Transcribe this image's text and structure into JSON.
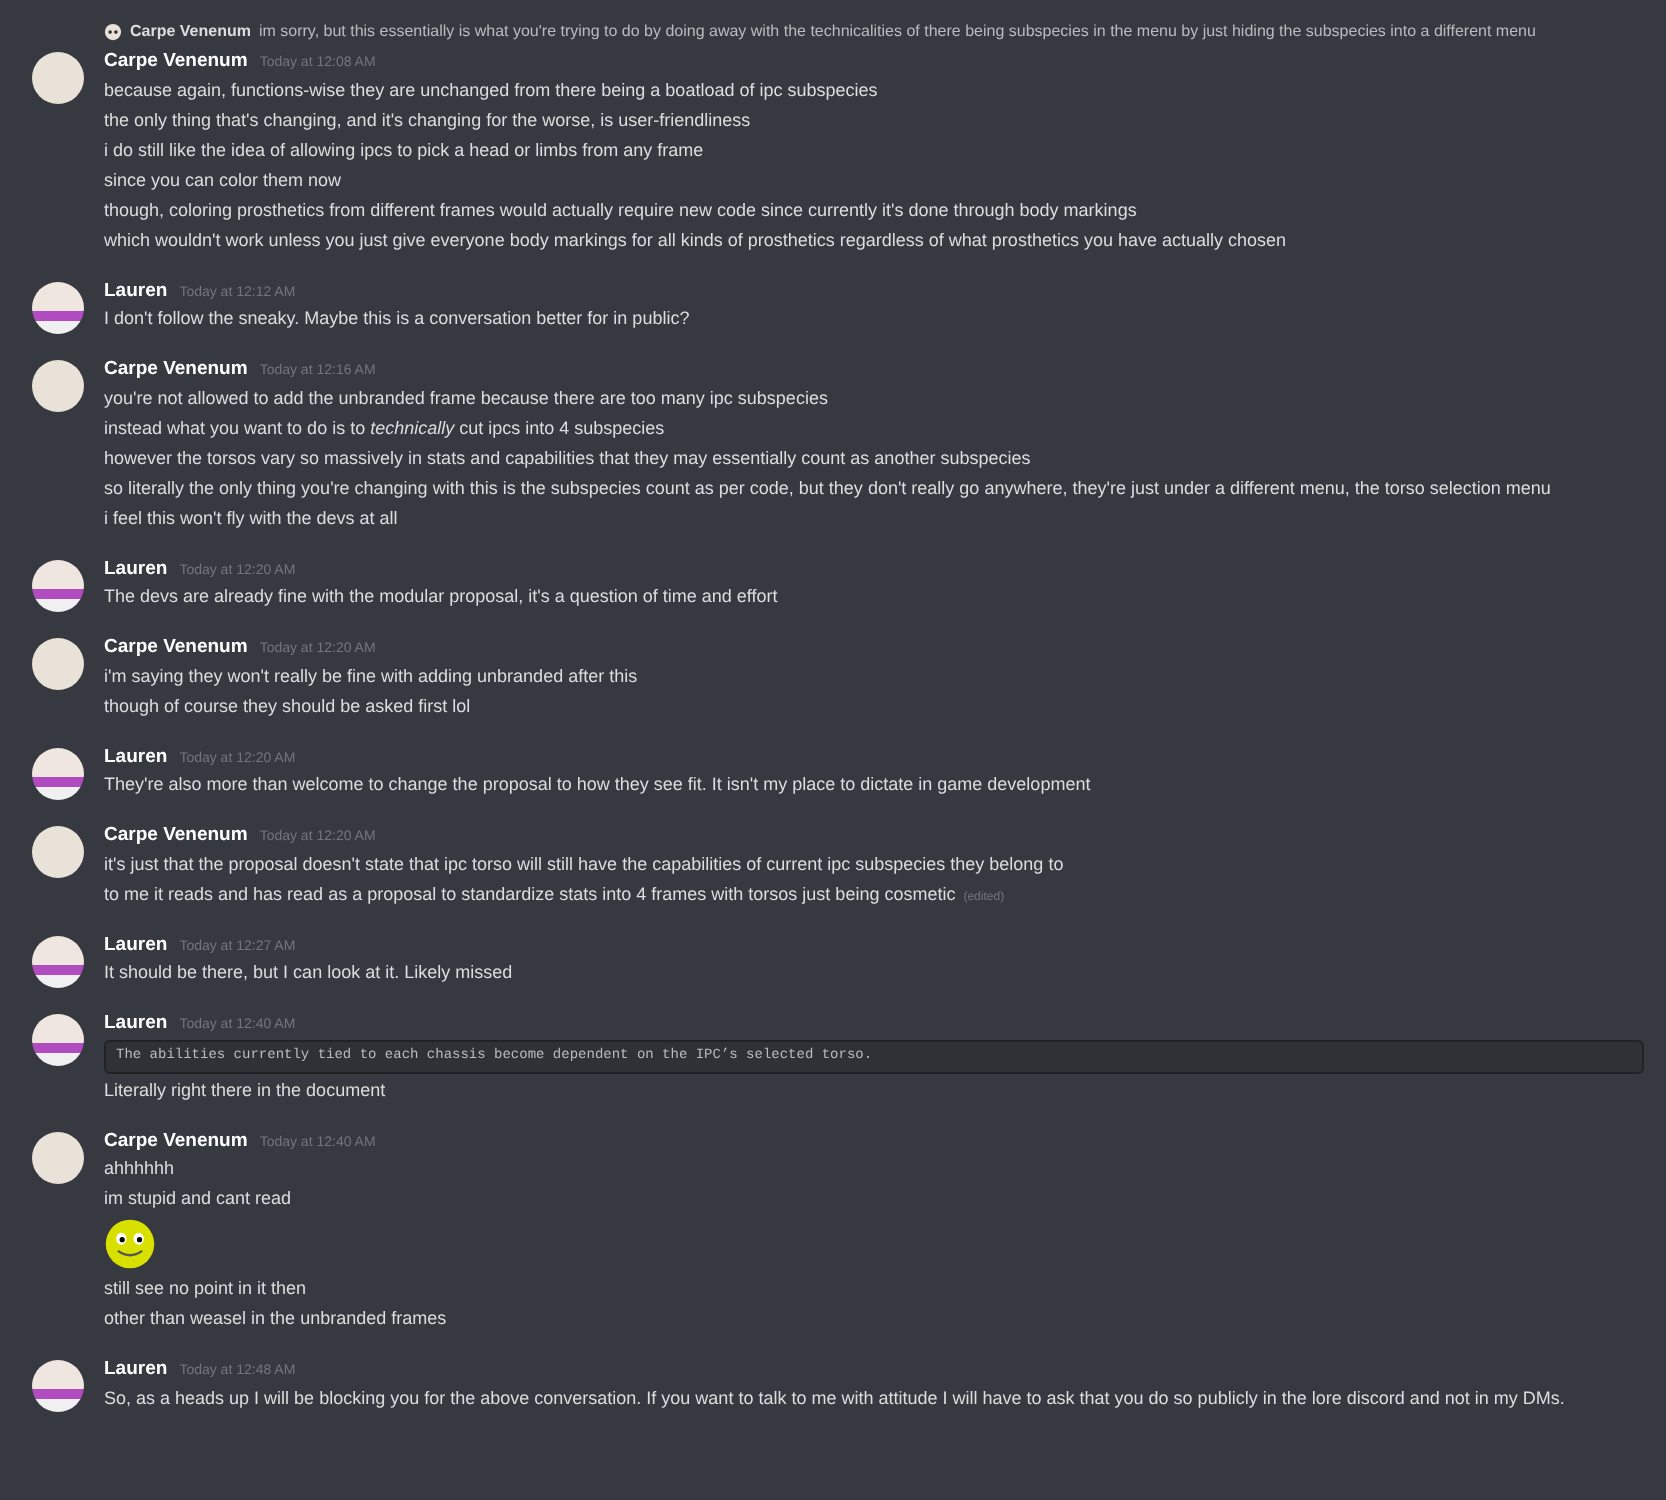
{
  "reply": {
    "author": "Carpe Venenum",
    "text": "im sorry, but this essentially is what you're trying to do by doing away with the technicalities of there being subspecies in the menu by just hiding the subspecies into a different menu"
  },
  "messages": [
    {
      "author": "Carpe Venenum",
      "kind": "cat",
      "time": "Today at 12:08 AM",
      "lines": [
        {
          "kind": "text",
          "text": "because again, functions-wise they are unchanged from there being a boatload of ipc subspecies"
        },
        {
          "kind": "text",
          "text": "the only thing that's changing, and it's changing for the worse, is user-friendliness"
        },
        {
          "kind": "text",
          "text": "i do still like the idea of allowing ipcs to pick a head or limbs from any frame"
        },
        {
          "kind": "text",
          "text": "since you can color them now"
        },
        {
          "kind": "text",
          "text": "though, coloring prosthetics from different frames would actually require new code since currently it's done through body markings"
        },
        {
          "kind": "text",
          "text": "which wouldn't work unless you just give everyone body markings for all kinds of prosthetics regardless of what prosthetics you have actually chosen"
        }
      ]
    },
    {
      "author": "Lauren",
      "kind": "person",
      "time": "Today at 12:12 AM",
      "lines": [
        {
          "kind": "text",
          "text": "I don't follow the sneaky. Maybe this is a conversation better for in public?"
        }
      ]
    },
    {
      "author": "Carpe Venenum",
      "kind": "cat",
      "time": "Today at 12:16 AM",
      "lines": [
        {
          "kind": "text",
          "text": "you're not allowed to add the unbranded frame because there are too many ipc subspecies"
        },
        {
          "kind": "text",
          "text": "instead what you want to do is to *technically* cut ipcs into 4 subspecies"
        },
        {
          "kind": "text",
          "text": "however the torsos vary so massively in stats and capabilities that they may essentially count as another subspecies"
        },
        {
          "kind": "text",
          "text": "so literally the only thing you're changing with this is the subspecies count as per code, but they don't really go anywhere, they're just under a different menu, the torso selection menu"
        },
        {
          "kind": "text",
          "text": "i feel this won't fly with the devs at all"
        }
      ]
    },
    {
      "author": "Lauren",
      "kind": "person",
      "time": "Today at 12:20 AM",
      "lines": [
        {
          "kind": "text",
          "text": "The devs are already fine with the modular proposal, it's a question of time and effort"
        }
      ]
    },
    {
      "author": "Carpe Venenum",
      "kind": "cat",
      "time": "Today at 12:20 AM",
      "lines": [
        {
          "kind": "text",
          "text": "i'm saying they won't really be fine with adding unbranded after this"
        },
        {
          "kind": "text",
          "text": "though of course they should be asked first lol"
        }
      ]
    },
    {
      "author": "Lauren",
      "kind": "person",
      "time": "Today at 12:20 AM",
      "lines": [
        {
          "kind": "text",
          "text": "They're also more than welcome to change the proposal to how they see fit. It isn't my place to dictate in game development"
        }
      ]
    },
    {
      "author": "Carpe Venenum",
      "kind": "cat",
      "time": "Today at 12:20 AM",
      "lines": [
        {
          "kind": "text",
          "text": "it's just that the proposal doesn't state that ipc torso will still have the capabilities of current ipc subspecies they belong to"
        },
        {
          "kind": "text",
          "text": "to me it reads and has read as a proposal to standardize stats into 4 frames with torsos just being cosmetic",
          "edited": "(edited)"
        }
      ]
    },
    {
      "author": "Lauren",
      "kind": "person",
      "time": "Today at 12:27 AM",
      "lines": [
        {
          "kind": "text",
          "text": "It should be there, but I can look at it. Likely missed"
        }
      ]
    },
    {
      "author": "Lauren",
      "kind": "person",
      "time": "Today at 12:40 AM",
      "lines": [
        {
          "kind": "code",
          "text": "The abilities currently tied to each chassis become dependent on the IPC’s selected torso."
        },
        {
          "kind": "text",
          "text": "Literally right there in the document"
        }
      ]
    },
    {
      "author": "Carpe Venenum",
      "kind": "cat",
      "time": "Today at 12:40 AM",
      "lines": [
        {
          "kind": "text",
          "text": "ahhhhhh"
        },
        {
          "kind": "text",
          "text": "im stupid and cant read"
        },
        {
          "kind": "emoji"
        },
        {
          "kind": "text",
          "text": "still see no point in it then"
        },
        {
          "kind": "text",
          "text": "other than weasel in the unbranded frames"
        }
      ]
    },
    {
      "author": "Lauren",
      "kind": "person",
      "time": "Today at 12:48 AM",
      "lines": [
        {
          "kind": "text",
          "text": "So, as a heads up I will be blocking you for the above conversation. If you want to talk to me with attitude I will have to ask that you do so publicly in the lore discord and not in my DMs."
        }
      ]
    }
  ]
}
